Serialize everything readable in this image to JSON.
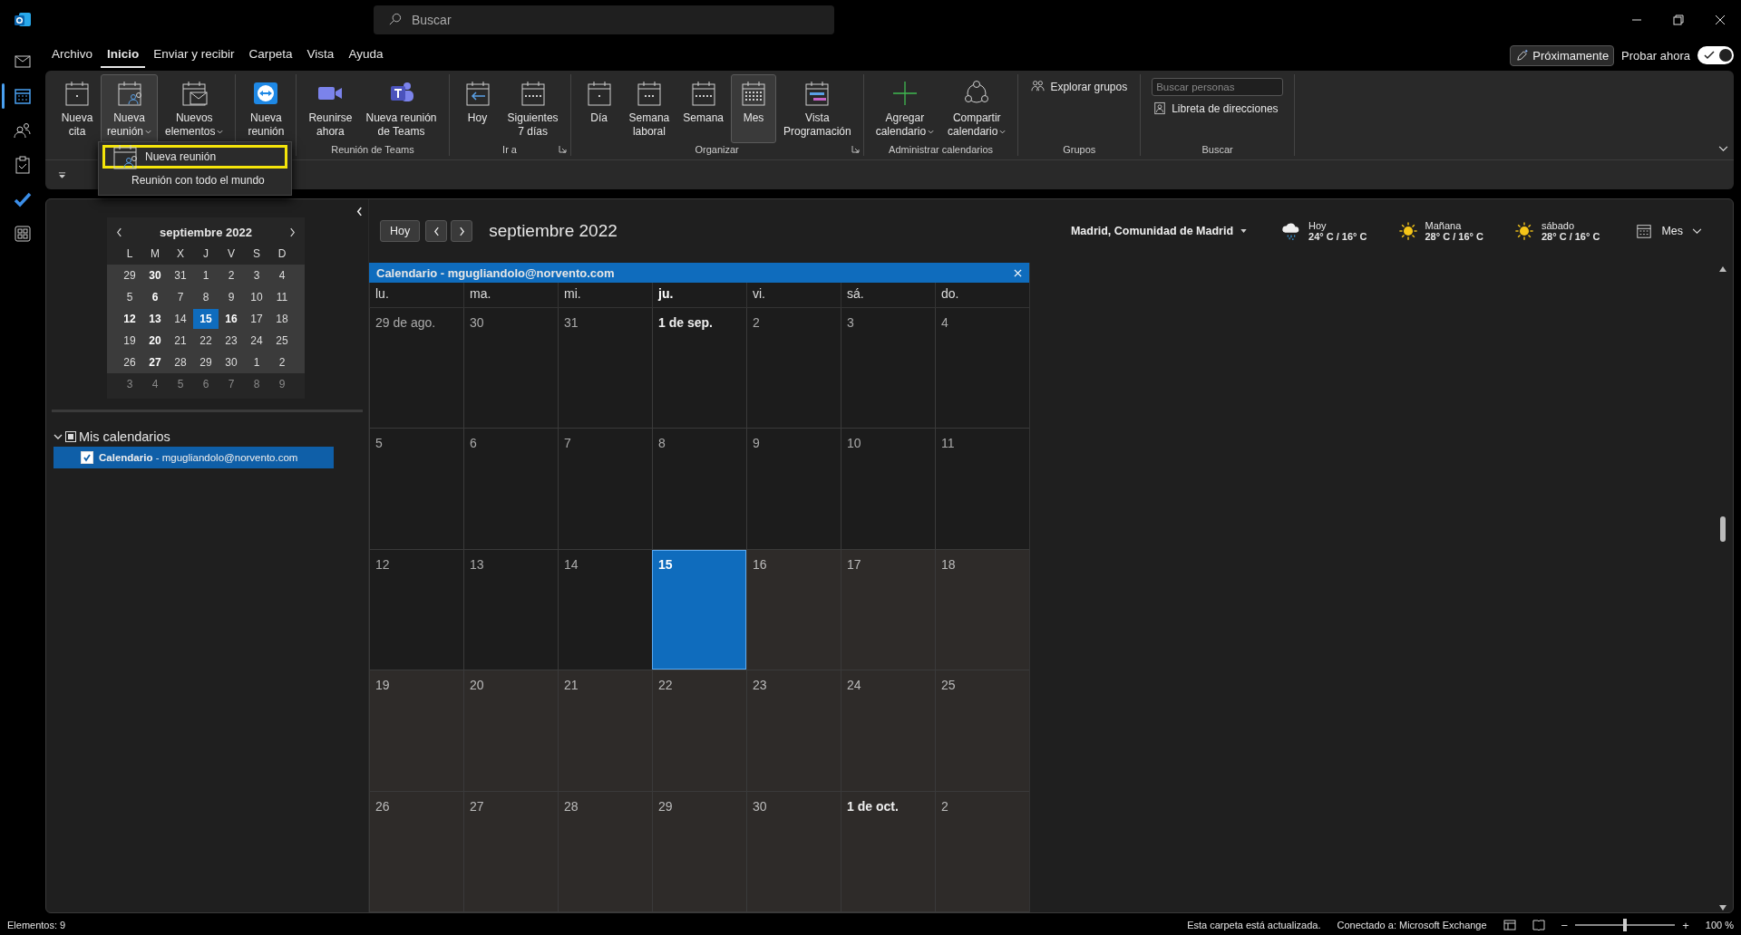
{
  "title_bar": {
    "search": {
      "placeholder": "Buscar"
    }
  },
  "menu_tabs": [
    {
      "label": "Archivo",
      "selected": false
    },
    {
      "label": "Inicio",
      "selected": true
    },
    {
      "label": "Enviar y recibir",
      "selected": false
    },
    {
      "label": "Carpeta",
      "selected": false
    },
    {
      "label": "Vista",
      "selected": false
    },
    {
      "label": "Ayuda",
      "selected": false
    }
  ],
  "coming_soon": {
    "button": "Próximamente",
    "toggle_label": "Probar ahora",
    "on": true
  },
  "ribbon": {
    "groups": [
      {
        "buttons": [
          {
            "label": "Nueva\ncita",
            "caret": false,
            "selected": false
          },
          {
            "label": "Nueva\nreunión",
            "caret": true,
            "selected": true
          },
          {
            "label": "Nuevos\nelementos",
            "caret": true,
            "selected": false
          }
        ]
      },
      {
        "buttons": [
          {
            "label": "Nueva\nreunión",
            "caret": false,
            "selected": false
          }
        ]
      },
      {
        "label": "Reunión de Teams",
        "buttons": [
          {
            "label": "Reunirse\nahora",
            "caret": false,
            "selected": false
          },
          {
            "label": "Nueva reunión\nde Teams",
            "caret": false,
            "selected": false
          }
        ]
      },
      {
        "label": "Ir a",
        "launcher": true,
        "buttons": [
          {
            "label": "Hoy",
            "caret": false,
            "selected": false
          },
          {
            "label": "Siguientes\n7 días",
            "caret": false,
            "selected": false
          }
        ]
      },
      {
        "label": "Organizar",
        "launcher": true,
        "buttons": [
          {
            "label": "Día",
            "caret": false,
            "selected": false
          },
          {
            "label": "Semana\nlaboral",
            "caret": false,
            "selected": false
          },
          {
            "label": "Semana",
            "caret": false,
            "selected": false
          },
          {
            "label": "Mes",
            "caret": false,
            "selected": true
          },
          {
            "label": "Vista\nProgramación",
            "caret": false,
            "selected": false
          }
        ]
      },
      {
        "label": "Administrar calendarios",
        "buttons": [
          {
            "label": "Agregar\ncalendario",
            "caret": true,
            "selected": false
          },
          {
            "label": "Compartir\ncalendario",
            "caret": true,
            "selected": false
          }
        ]
      },
      {
        "label": "Grupos",
        "small": [
          {
            "label": "Explorar grupos"
          }
        ]
      },
      {
        "label": "Buscar",
        "field": {
          "placeholder": "Buscar personas"
        },
        "small": [
          {
            "label": "Libreta de direcciones"
          }
        ]
      }
    ]
  },
  "dropdown": {
    "items": [
      {
        "label": "Nueva reunión",
        "selected": true
      },
      {
        "label": "Reunión con todo el mundo",
        "selected": false
      }
    ]
  },
  "mini_calendar": {
    "title": "septiembre 2022",
    "weekdays": [
      "L",
      "M",
      "X",
      "J",
      "V",
      "S",
      "D"
    ],
    "weeks": [
      {
        "shaded": true,
        "days": [
          {
            "text": "29",
            "bold": false,
            "selected": false
          },
          {
            "text": "30",
            "bold": true,
            "selected": false
          },
          {
            "text": "31",
            "bold": false,
            "selected": false
          },
          {
            "text": "1",
            "bold": false,
            "selected": false
          },
          {
            "text": "2",
            "bold": false,
            "selected": false
          },
          {
            "text": "3",
            "bold": false,
            "selected": false
          },
          {
            "text": "4",
            "bold": false,
            "selected": false
          }
        ]
      },
      {
        "shaded": true,
        "days": [
          {
            "text": "5",
            "bold": false,
            "selected": false
          },
          {
            "text": "6",
            "bold": true,
            "selected": false
          },
          {
            "text": "7",
            "bold": false,
            "selected": false
          },
          {
            "text": "8",
            "bold": false,
            "selected": false
          },
          {
            "text": "9",
            "bold": false,
            "selected": false
          },
          {
            "text": "10",
            "bold": false,
            "selected": false
          },
          {
            "text": "11",
            "bold": false,
            "selected": false
          }
        ]
      },
      {
        "shaded": true,
        "days": [
          {
            "text": "12",
            "bold": true,
            "selected": false
          },
          {
            "text": "13",
            "bold": true,
            "selected": false
          },
          {
            "text": "14",
            "bold": false,
            "selected": false
          },
          {
            "text": "15",
            "bold": true,
            "selected": true
          },
          {
            "text": "16",
            "bold": true,
            "selected": false
          },
          {
            "text": "17",
            "bold": false,
            "selected": false
          },
          {
            "text": "18",
            "bold": false,
            "selected": false
          }
        ]
      },
      {
        "shaded": true,
        "days": [
          {
            "text": "19",
            "bold": false,
            "selected": false
          },
          {
            "text": "20",
            "bold": true,
            "selected": false
          },
          {
            "text": "21",
            "bold": false,
            "selected": false
          },
          {
            "text": "22",
            "bold": false,
            "selected": false
          },
          {
            "text": "23",
            "bold": false,
            "selected": false
          },
          {
            "text": "24",
            "bold": false,
            "selected": false
          },
          {
            "text": "25",
            "bold": false,
            "selected": false
          }
        ]
      },
      {
        "shaded": true,
        "days": [
          {
            "text": "26",
            "bold": false,
            "selected": false
          },
          {
            "text": "27",
            "bold": true,
            "selected": false
          },
          {
            "text": "28",
            "bold": false,
            "selected": false
          },
          {
            "text": "29",
            "bold": false,
            "selected": false
          },
          {
            "text": "30",
            "bold": false,
            "selected": false
          },
          {
            "text": "1",
            "bold": false,
            "selected": false
          },
          {
            "text": "2",
            "bold": false,
            "selected": false
          }
        ]
      },
      {
        "shaded": false,
        "days": [
          {
            "text": "3",
            "bold": false,
            "selected": false
          },
          {
            "text": "4",
            "bold": false,
            "selected": false
          },
          {
            "text": "5",
            "bold": false,
            "selected": false
          },
          {
            "text": "6",
            "bold": false,
            "selected": false
          },
          {
            "text": "7",
            "bold": false,
            "selected": false
          },
          {
            "text": "8",
            "bold": false,
            "selected": false
          },
          {
            "text": "9",
            "bold": false,
            "selected": false
          }
        ]
      }
    ]
  },
  "folders": [
    {
      "label": "Mis calendarios",
      "expanded": true,
      "mixed": true,
      "children": [
        {
          "label": "**Calendario** - mgugliandolo@norvento.com",
          "checked": true,
          "selected": true
        }
      ]
    }
  ],
  "calendar_header": {
    "today_button": "Hoy",
    "title": "septiembre 2022",
    "location": "Madrid, Comunidad de Madrid",
    "view": "Mes"
  },
  "weather": [
    {
      "kind": "rain",
      "day": "Hoy",
      "temps": "24° C / 16° C"
    },
    {
      "kind": "sun",
      "day": "Mañana",
      "temps": "28° C / 16° C"
    },
    {
      "kind": "sun",
      "day": "sábado",
      "temps": "28° C / 16° C"
    }
  ],
  "calendar_tab": {
    "title": "Calendario - mgugliandolo@norvento.com"
  },
  "day_names": [
    {
      "text": "lu.",
      "bold": false
    },
    {
      "text": "ma.",
      "bold": false
    },
    {
      "text": "mi.",
      "bold": false
    },
    {
      "text": "ju.",
      "bold": true
    },
    {
      "text": "vi.",
      "bold": false
    },
    {
      "text": "sá.",
      "bold": false
    },
    {
      "text": "do.",
      "bold": false
    }
  ],
  "weeks": [
    [
      {
        "text": "29 de ago.",
        "past": true,
        "bold": false,
        "selected": false
      },
      {
        "text": "30",
        "past": true,
        "bold": false,
        "selected": false
      },
      {
        "text": "31",
        "past": true,
        "bold": false,
        "selected": false
      },
      {
        "text": "1 de sep.",
        "past": true,
        "bold": true,
        "selected": false
      },
      {
        "text": "2",
        "past": true,
        "bold": false,
        "selected": false
      },
      {
        "text": "3",
        "past": true,
        "bold": false,
        "selected": false
      },
      {
        "text": "4",
        "past": true,
        "bold": false,
        "selected": false
      }
    ],
    [
      {
        "text": "5",
        "past": true,
        "bold": false,
        "selected": false
      },
      {
        "text": "6",
        "past": true,
        "bold": false,
        "selected": false
      },
      {
        "text": "7",
        "past": true,
        "bold": false,
        "selected": false
      },
      {
        "text": "8",
        "past": true,
        "bold": false,
        "selected": false
      },
      {
        "text": "9",
        "past": true,
        "bold": false,
        "selected": false
      },
      {
        "text": "10",
        "past": true,
        "bold": false,
        "selected": false
      },
      {
        "text": "11",
        "past": true,
        "bold": false,
        "selected": false
      }
    ],
    [
      {
        "text": "12",
        "past": true,
        "bold": false,
        "selected": false
      },
      {
        "text": "13",
        "past": true,
        "bold": false,
        "selected": false
      },
      {
        "text": "14",
        "past": true,
        "bold": false,
        "selected": false
      },
      {
        "text": "15",
        "past": false,
        "bold": true,
        "selected": true
      },
      {
        "text": "16",
        "past": false,
        "bold": false,
        "selected": false
      },
      {
        "text": "17",
        "past": false,
        "bold": false,
        "selected": false
      },
      {
        "text": "18",
        "past": false,
        "bold": false,
        "selected": false
      }
    ],
    [
      {
        "text": "19",
        "past": false,
        "bold": false,
        "selected": false
      },
      {
        "text": "20",
        "past": false,
        "bold": false,
        "selected": false
      },
      {
        "text": "21",
        "past": false,
        "bold": false,
        "selected": false
      },
      {
        "text": "22",
        "past": false,
        "bold": false,
        "selected": false
      },
      {
        "text": "23",
        "past": false,
        "bold": false,
        "selected": false
      },
      {
        "text": "24",
        "past": false,
        "bold": false,
        "selected": false
      },
      {
        "text": "25",
        "past": false,
        "bold": false,
        "selected": false
      }
    ],
    [
      {
        "text": "26",
        "past": false,
        "bold": false,
        "selected": false
      },
      {
        "text": "27",
        "past": false,
        "bold": false,
        "selected": false
      },
      {
        "text": "28",
        "past": false,
        "bold": false,
        "selected": false
      },
      {
        "text": "29",
        "past": false,
        "bold": false,
        "selected": false
      },
      {
        "text": "30",
        "past": false,
        "bold": false,
        "selected": false
      },
      {
        "text": "1 de oct.",
        "past": false,
        "bold": true,
        "selected": false
      },
      {
        "text": "2",
        "past": false,
        "bold": false,
        "selected": false
      }
    ]
  ],
  "status_bar": {
    "items_count": "Elementos: 9",
    "sync": "Esta carpeta está actualizada.",
    "connection": "Conectado a: Microsoft Exchange",
    "zoom_minus": "−",
    "zoom_plus": "+",
    "zoom": {
      "level": 0.5
    },
    "zoom_text": "100 %"
  }
}
